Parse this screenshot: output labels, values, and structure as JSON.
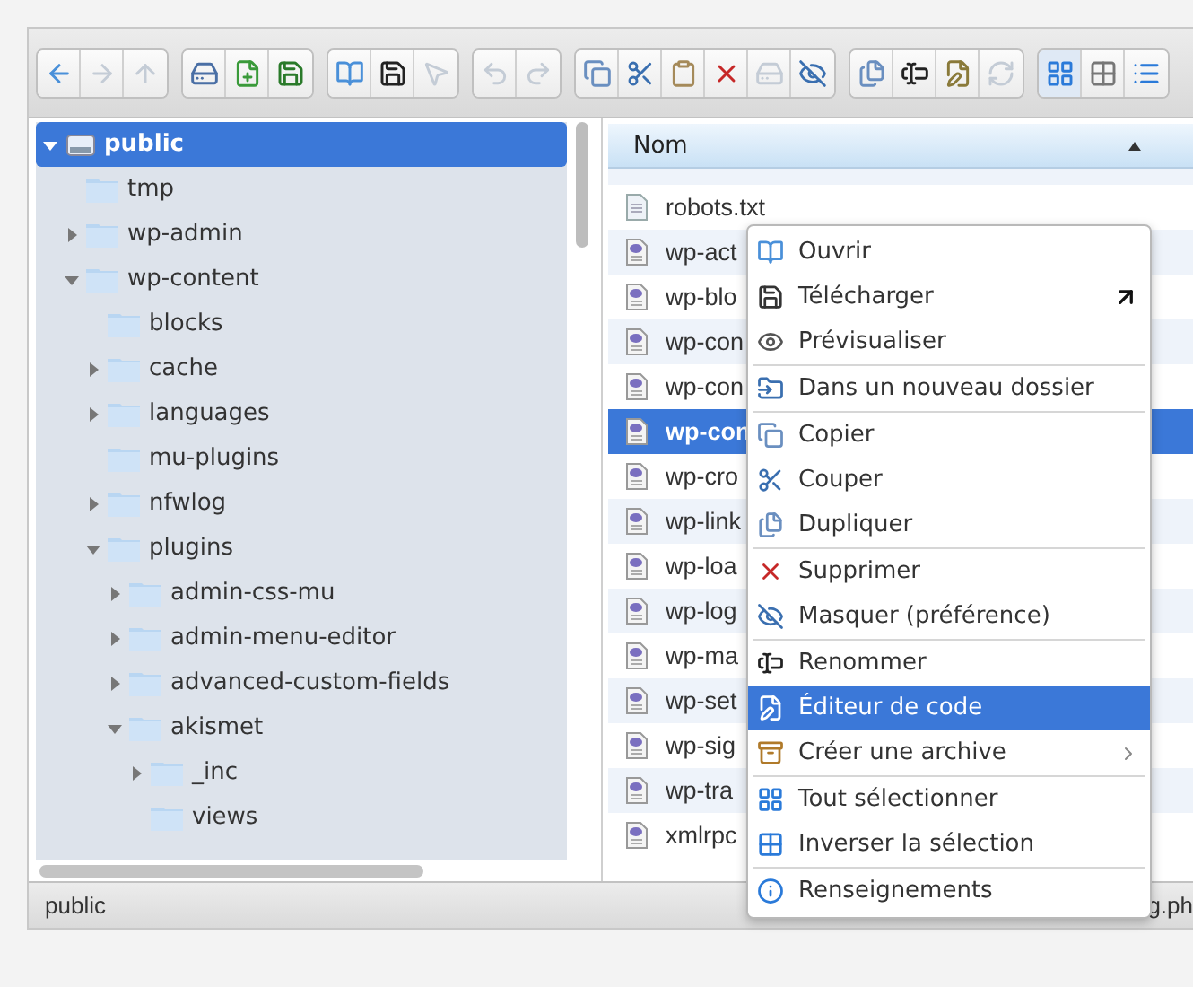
{
  "toolbar": {
    "groups": [
      {
        "buttons": [
          {
            "disabled": false,
            "selected": false
          },
          {
            "disabled": true,
            "selected": false
          },
          {
            "disabled": true,
            "selected": false
          }
        ]
      },
      {
        "buttons": [
          {
            "disabled": false,
            "selected": false
          },
          {
            "disabled": false,
            "selected": false
          },
          {
            "disabled": false,
            "selected": false
          }
        ]
      },
      {
        "buttons": [
          {
            "disabled": false,
            "selected": false
          },
          {
            "disabled": false,
            "selected": false
          },
          {
            "disabled": true,
            "selected": false
          }
        ]
      },
      {
        "buttons": [
          {
            "disabled": true,
            "selected": false
          },
          {
            "disabled": true,
            "selected": false
          }
        ]
      },
      {
        "buttons": [
          {
            "disabled": false,
            "selected": false
          },
          {
            "disabled": false,
            "selected": false
          },
          {
            "disabled": false,
            "selected": false
          },
          {
            "disabled": false,
            "selected": false
          },
          {
            "disabled": true,
            "selected": false
          },
          {
            "disabled": false,
            "selected": false
          }
        ]
      },
      {
        "buttons": [
          {
            "disabled": false,
            "selected": false
          },
          {
            "disabled": false,
            "selected": false
          },
          {
            "disabled": false,
            "selected": false
          },
          {
            "disabled": true,
            "selected": false
          }
        ]
      },
      {
        "buttons": [
          {
            "disabled": false,
            "selected": true
          },
          {
            "disabled": false,
            "selected": false
          },
          {
            "disabled": false,
            "selected": false
          }
        ]
      }
    ]
  },
  "tree": [
    {
      "label": "public",
      "kind": "drive",
      "expandable": true,
      "expanded": true,
      "selected": true,
      "children": [
        {
          "label": "tmp",
          "kind": "folder",
          "expandable": false,
          "expanded": false,
          "selected": false
        },
        {
          "label": "wp-admin",
          "kind": "folder",
          "expandable": true,
          "expanded": false,
          "selected": false
        },
        {
          "label": "wp-content",
          "kind": "folder",
          "expandable": true,
          "expanded": true,
          "selected": false,
          "children": [
            {
              "label": "blocks",
              "kind": "folder",
              "expandable": false,
              "expanded": false,
              "selected": false
            },
            {
              "label": "cache",
              "kind": "folder",
              "expandable": true,
              "expanded": false,
              "selected": false
            },
            {
              "label": "languages",
              "kind": "folder",
              "expandable": true,
              "expanded": false,
              "selected": false
            },
            {
              "label": "mu-plugins",
              "kind": "folder",
              "expandable": false,
              "expanded": false,
              "selected": false
            },
            {
              "label": "nfwlog",
              "kind": "folder",
              "expandable": true,
              "expanded": false,
              "selected": false
            },
            {
              "label": "plugins",
              "kind": "folder",
              "expandable": true,
              "expanded": true,
              "selected": false,
              "children": [
                {
                  "label": "admin-css-mu",
                  "kind": "folder",
                  "expandable": true,
                  "expanded": false,
                  "selected": false
                },
                {
                  "label": "admin-menu-editor",
                  "kind": "folder",
                  "expandable": true,
                  "expanded": false,
                  "selected": false
                },
                {
                  "label": "advanced-custom-fields",
                  "kind": "folder",
                  "expandable": true,
                  "expanded": false,
                  "selected": false
                },
                {
                  "label": "akismet",
                  "kind": "folder",
                  "expandable": true,
                  "expanded": true,
                  "selected": false,
                  "children": [
                    {
                      "label": "_inc",
                      "kind": "folder",
                      "expandable": true,
                      "expanded": false,
                      "selected": false
                    },
                    {
                      "label": "views",
                      "kind": "folder",
                      "expandable": false,
                      "expanded": false,
                      "selected": false
                    }
                  ]
                }
              ]
            }
          ]
        }
      ]
    }
  ],
  "files": {
    "column": "Nom",
    "rows": [
      {
        "name": "robots.txt",
        "kind": "text",
        "selected": false
      },
      {
        "name": "wp-act",
        "kind": "php",
        "selected": false
      },
      {
        "name": "wp-blo",
        "kind": "php",
        "selected": false
      },
      {
        "name": "wp-con",
        "kind": "php",
        "selected": false
      },
      {
        "name": "wp-con",
        "kind": "php",
        "selected": false
      },
      {
        "name": "wp-con",
        "kind": "php",
        "selected": true
      },
      {
        "name": "wp-cro",
        "kind": "php",
        "selected": false
      },
      {
        "name": "wp-link",
        "kind": "php",
        "selected": false
      },
      {
        "name": "wp-loa",
        "kind": "php",
        "selected": false
      },
      {
        "name": "wp-log",
        "kind": "php",
        "selected": false
      },
      {
        "name": "wp-ma",
        "kind": "php",
        "selected": false
      },
      {
        "name": "wp-set",
        "kind": "php",
        "selected": false
      },
      {
        "name": "wp-sig",
        "kind": "php",
        "selected": false
      },
      {
        "name": "wp-tra",
        "kind": "php",
        "selected": false
      },
      {
        "name": "xmlrpc",
        "kind": "php",
        "selected": false
      }
    ]
  },
  "status_bar": {
    "left": "public",
    "right": "g.ph"
  },
  "context_menu": {
    "groups": [
      {
        "items": [
          {
            "label": "Ouvrir",
            "selected": false,
            "submenu": false,
            "external": false
          },
          {
            "label": "Télécharger",
            "selected": false,
            "submenu": false,
            "external": true
          },
          {
            "label": "Prévisualiser",
            "selected": false,
            "submenu": false,
            "external": false
          }
        ]
      },
      {
        "items": [
          {
            "label": "Dans un nouveau dossier",
            "selected": false,
            "submenu": false,
            "external": false
          }
        ]
      },
      {
        "items": [
          {
            "label": "Copier",
            "selected": false,
            "submenu": false,
            "external": false
          },
          {
            "label": "Couper",
            "selected": false,
            "submenu": false,
            "external": false
          },
          {
            "label": "Dupliquer",
            "selected": false,
            "submenu": false,
            "external": false
          }
        ]
      },
      {
        "items": [
          {
            "label": "Supprimer",
            "selected": false,
            "submenu": false,
            "external": false
          },
          {
            "label": "Masquer (préférence)",
            "selected": false,
            "submenu": false,
            "external": false
          }
        ]
      },
      {
        "items": [
          {
            "label": "Renommer",
            "selected": false,
            "submenu": false,
            "external": false
          },
          {
            "label": "Éditeur de code",
            "selected": true,
            "submenu": false,
            "external": false
          },
          {
            "label": "Créer une archive",
            "selected": false,
            "submenu": true,
            "external": false
          }
        ]
      },
      {
        "items": [
          {
            "label": "Tout sélectionner",
            "selected": false,
            "submenu": false,
            "external": false
          },
          {
            "label": "Inverser la sélection",
            "selected": false,
            "submenu": false,
            "external": false
          }
        ]
      },
      {
        "items": [
          {
            "label": "Renseignements",
            "selected": false,
            "submenu": false,
            "external": false
          }
        ]
      }
    ]
  }
}
